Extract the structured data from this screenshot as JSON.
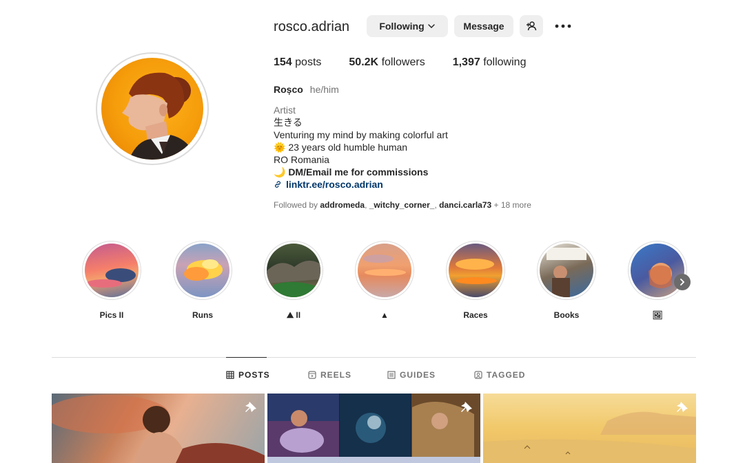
{
  "profile": {
    "username": "rosco.adrian",
    "buttons": {
      "following": "Following",
      "message": "Message"
    },
    "stats": {
      "posts_count": "154",
      "posts_label": "posts",
      "followers_count": "50.2K",
      "followers_label": "followers",
      "following_count": "1,397",
      "following_label": "following"
    },
    "display_name": "Roșco",
    "pronouns": "he/him",
    "category": "Artist",
    "bio_lines": [
      "生きる",
      "Venturing my mind by making colorful art",
      "🌞 23 years old humble human",
      "RO Romania",
      "🌙 DM/Email me for commissions"
    ],
    "link": "linktr.ee/rosco.adrian",
    "followed_by": {
      "prefix": "Followed by",
      "users": [
        "addromeda",
        "_witchy_corner_",
        "danci.carla73"
      ],
      "suffix": "+ 18 more"
    }
  },
  "highlights": [
    {
      "label": "Pics II"
    },
    {
      "label": "Runs"
    },
    {
      "label": "⛰ II"
    },
    {
      "label": "▲"
    },
    {
      "label": "Races"
    },
    {
      "label": "Books"
    },
    {
      "label": "🖼"
    }
  ],
  "tabs": [
    {
      "label": "POSTS",
      "icon": "grid-icon",
      "active": true
    },
    {
      "label": "REELS",
      "icon": "reels-icon",
      "active": false
    },
    {
      "label": "GUIDES",
      "icon": "guides-icon",
      "active": false
    },
    {
      "label": "TAGGED",
      "icon": "tagged-icon",
      "active": false
    }
  ],
  "colors": {
    "link": "#00376b",
    "secondary_text": "#737373",
    "button_bg": "#efefef",
    "border": "#dbdbdb"
  }
}
